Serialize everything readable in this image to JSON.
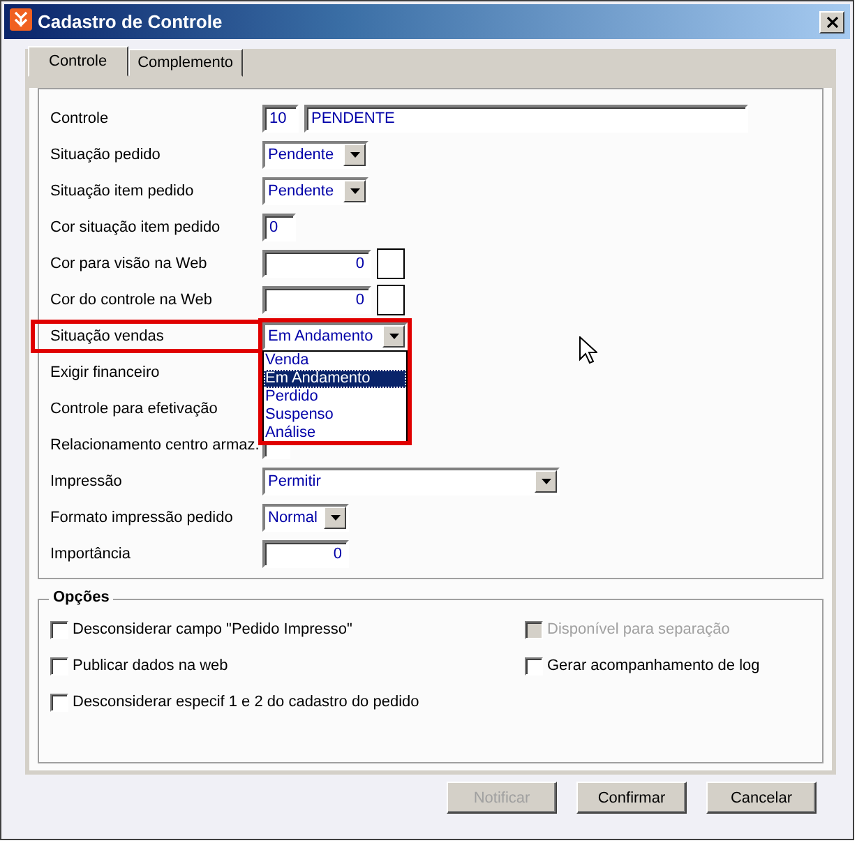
{
  "window": {
    "title": "Cadastro de Controle"
  },
  "tabs": [
    {
      "label": "Controle",
      "selected": true
    },
    {
      "label": "Complemento",
      "selected": false
    }
  ],
  "fields": [
    {
      "label": "Controle",
      "kind": "text-pair",
      "code": "10",
      "value": "PENDENTE"
    },
    {
      "label": "Situação pedido",
      "kind": "combo",
      "value": "Pendente"
    },
    {
      "label": "Situação item pedido",
      "kind": "combo",
      "value": "Pendente"
    },
    {
      "label": "Cor situação item pedido",
      "kind": "short-text",
      "value": "0"
    },
    {
      "label": "Cor para visão na Web",
      "kind": "color-number",
      "value": "0"
    },
    {
      "label": "Cor do controle na Web",
      "kind": "color-number",
      "value": "0"
    },
    {
      "label": "Situação vendas",
      "kind": "combo",
      "value": "Em Andamento",
      "highlighted": true,
      "expanded": true,
      "options": [
        {
          "text": "Venda",
          "selected": false
        },
        {
          "text": "Em Andamento",
          "selected": true
        },
        {
          "text": "Perdido",
          "selected": false
        },
        {
          "text": "Suspenso",
          "selected": false
        },
        {
          "text": "Análise",
          "selected": false
        }
      ]
    },
    {
      "label": "Exigir financeiro",
      "kind": "hidden"
    },
    {
      "label": "Controle para efetivação",
      "kind": "hidden"
    },
    {
      "label": "Relacionamento centro armaz.",
      "kind": "blank"
    },
    {
      "label": "Impressão",
      "kind": "combo-wide",
      "value": "Permitir"
    },
    {
      "label": "Formato impressão pedido",
      "kind": "combo-small",
      "value": "Normal"
    },
    {
      "label": "Importância",
      "kind": "number",
      "value": "0"
    }
  ],
  "options": {
    "title": "Opções",
    "left": [
      {
        "label": "Desconsiderar campo \"Pedido Impresso\"",
        "checked": false,
        "disabled": false
      },
      {
        "label": "Publicar dados na web",
        "checked": false,
        "disabled": false
      },
      {
        "label": "Desconsiderar especif 1 e 2 do cadastro do pedido",
        "checked": false,
        "disabled": false
      }
    ],
    "right": [
      {
        "label": "Disponível para separação",
        "checked": false,
        "disabled": true
      },
      {
        "label": "Gerar acompanhamento de log",
        "checked": false,
        "disabled": false
      }
    ]
  },
  "buttons": [
    {
      "label": "Notificar",
      "disabled": true
    },
    {
      "label": "Confirmar",
      "disabled": false
    },
    {
      "label": "Cancelar",
      "disabled": false
    }
  ]
}
